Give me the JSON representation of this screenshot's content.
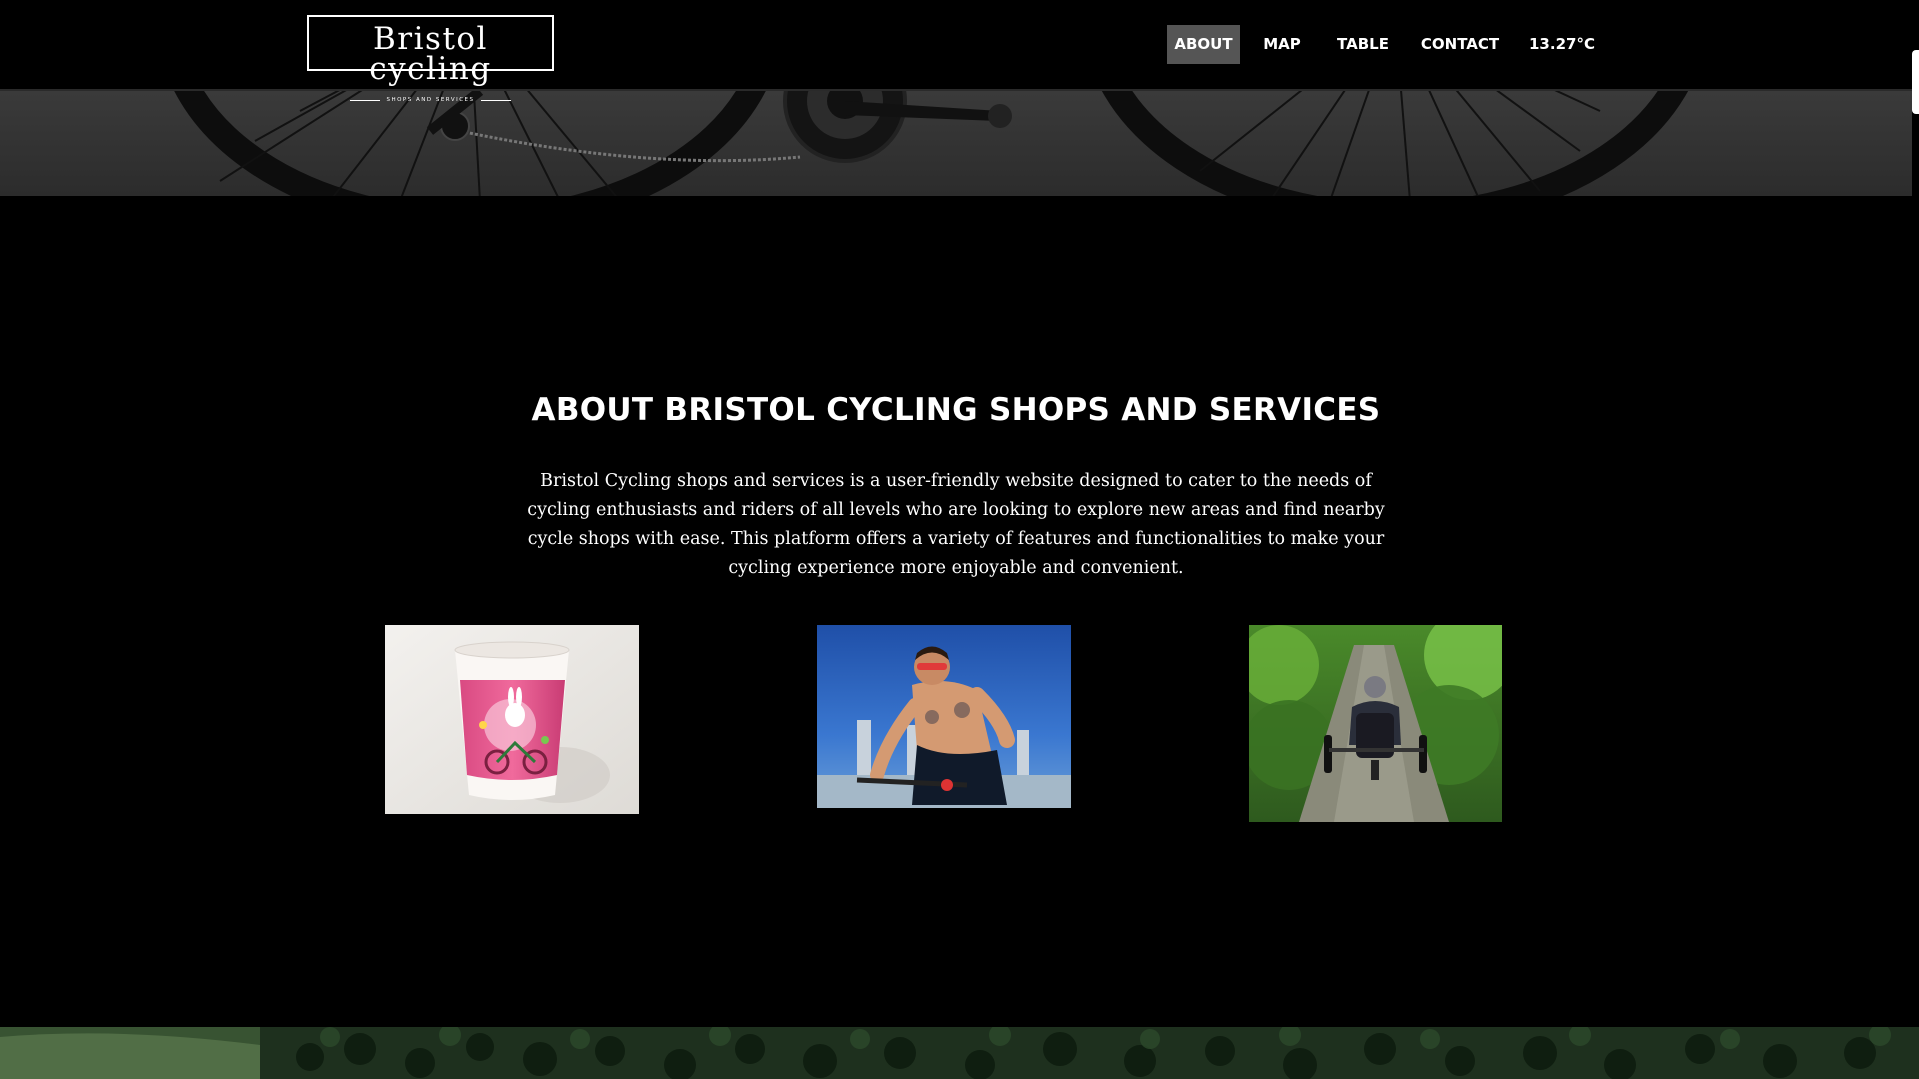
{
  "header": {
    "logo": {
      "title": "Bristol cycling",
      "subtitle": "SHOPS AND SERVICES"
    },
    "nav": [
      {
        "label": "ABOUT",
        "active": true
      },
      {
        "label": "MAP",
        "active": false
      },
      {
        "label": "TABLE",
        "active": false
      },
      {
        "label": "CONTACT",
        "active": false
      }
    ],
    "temperature": "13.27°C"
  },
  "about": {
    "title": "ABOUT BRISTOL CYCLING SHOPS AND SERVICES",
    "description": "Bristol Cycling shops and services is a user-friendly website designed to cater to the needs of cycling enthusiasts and riders of all levels who are looking to explore new areas and find nearby cycle shops with ease. This platform offers a variety of features and functionalities to make your cycling experience more enjoyable and convenient."
  },
  "photos": [
    {
      "name": "cup-with-bunny-on-bicycle"
    },
    {
      "name": "shirtless-cyclist"
    },
    {
      "name": "recumbent-trike-rider-on-forest-path"
    }
  ],
  "colors": {
    "background": "#000000",
    "text": "#ffffff",
    "nav_active": "#555555"
  }
}
